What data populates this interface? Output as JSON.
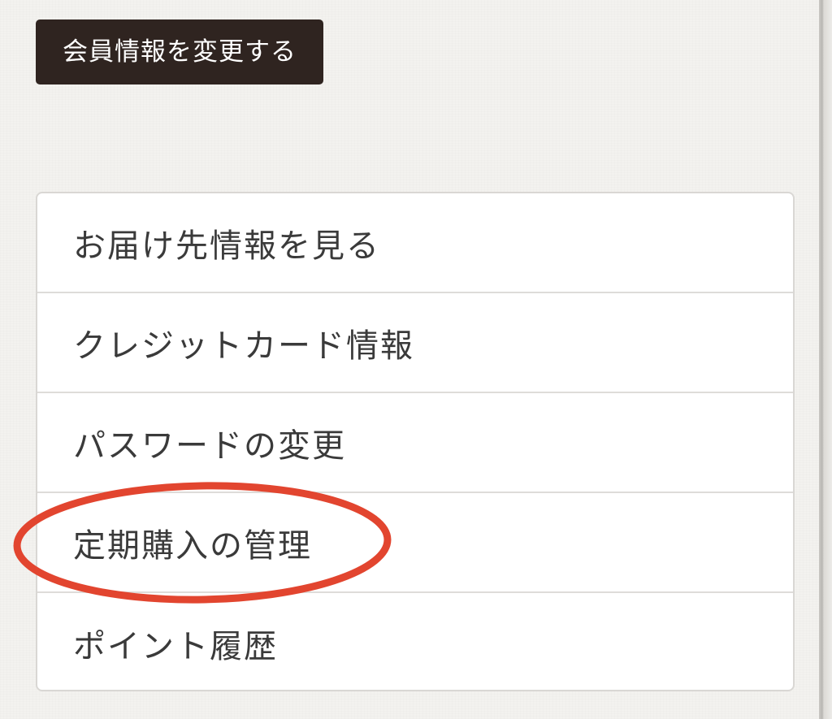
{
  "header": {
    "edit_profile_label": "会員情報を変更する"
  },
  "menu": {
    "items": [
      {
        "label": "お届け先情報を見る"
      },
      {
        "label": "クレジットカード情報"
      },
      {
        "label": "パスワードの変更"
      },
      {
        "label": "定期購入の管理"
      },
      {
        "label": "ポイント履歴"
      }
    ]
  },
  "annotation": {
    "highlight_color": "#e2452f",
    "highlighted_item": "定期購入の管理"
  }
}
